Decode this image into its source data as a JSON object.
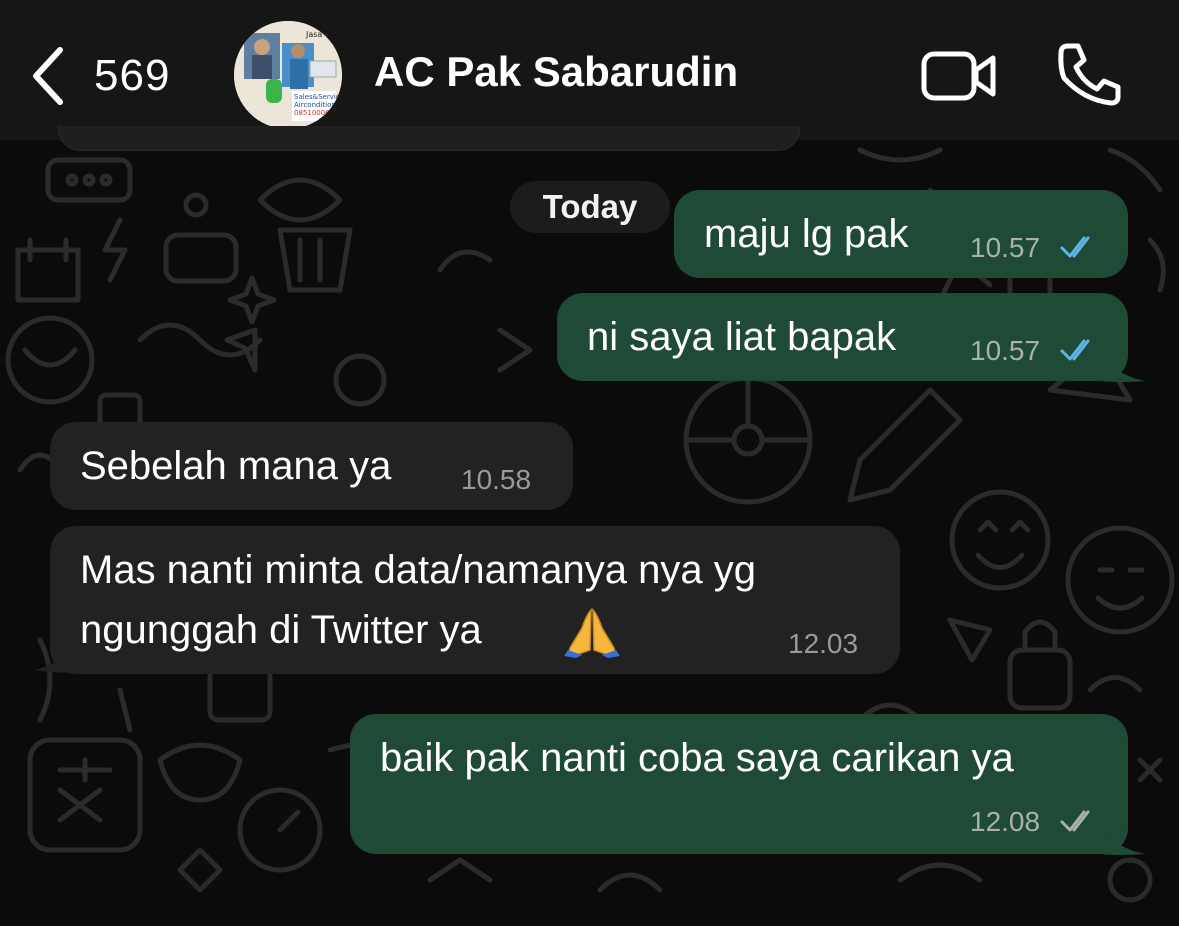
{
  "header": {
    "back_count": "569",
    "contact_name": "AC Pak Sabarudin",
    "avatar_text": [
      "Jasa Teknik",
      "Sales&Service",
      "Airconditioner",
      "085100067…"
    ]
  },
  "chat": {
    "date_separator": "Today",
    "messages": [
      {
        "direction": "out",
        "text": "maju lg pak",
        "time": "10.57",
        "status": "read"
      },
      {
        "direction": "out",
        "text": "ni saya liat bapak",
        "time": "10.57",
        "status": "read"
      },
      {
        "direction": "in",
        "text": "Sebelah mana ya",
        "time": "10.58"
      },
      {
        "direction": "in",
        "lines": [
          "Mas nanti minta data/namanya  nya yg",
          "ngunggah di Twitter ya"
        ],
        "emoji": "🙏",
        "time": "12.03"
      },
      {
        "direction": "out",
        "text": "baik pak nanti coba saya carikan ya",
        "time": "12.08",
        "status": "delivered"
      }
    ]
  },
  "colors": {
    "outgoing_bubble": "#1f4a36",
    "incoming_bubble": "#222222",
    "read_ticks": "#5fb4ea",
    "delivered_ticks": "#a9b1ad",
    "background": "#0b0b0b"
  },
  "icons": [
    "back-chevron-icon",
    "video-call-icon",
    "phone-call-icon",
    "double-check-icon",
    "folded-hands-emoji"
  ]
}
